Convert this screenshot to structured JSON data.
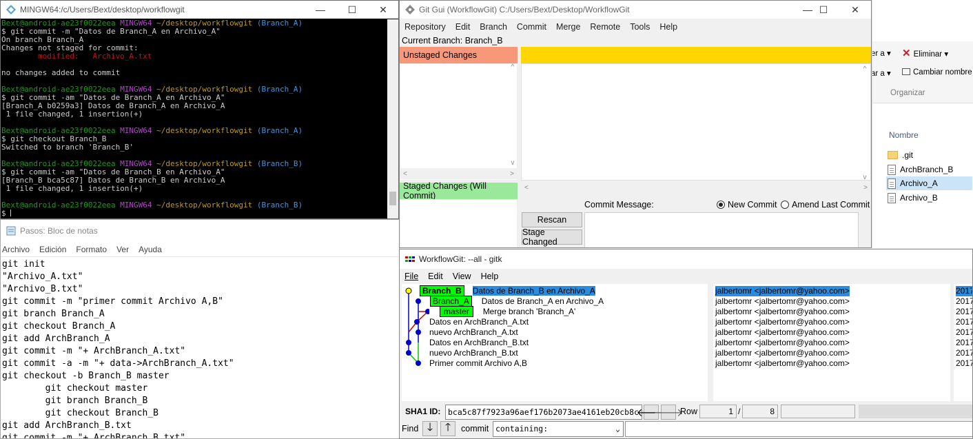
{
  "explorer": {
    "ribbon_items": [
      {
        "label": "er a",
        "caret": "▾"
      },
      {
        "label": "Eliminar",
        "caret": "▾"
      },
      {
        "label": "ar a",
        "caret": "▾"
      },
      {
        "label": "Cambiar nombre"
      }
    ],
    "group_label": "Organizar",
    "column_header": "Nombre",
    "files": [
      ".git",
      "ArchBranch_B",
      "Archivo_A",
      "Archivo_B"
    ],
    "selected_file": "Archivo_A"
  },
  "terminal": {
    "title": "MINGW64:/c/Users/Bext/desktop/workflowgit",
    "lines": [
      [
        [
          "g",
          "Bext@android-ae23f0022eea "
        ],
        [
          "m",
          "MINGW64 "
        ],
        [
          "y",
          "~/desktop/workflowgit "
        ],
        [
          "c",
          "(Branch_A)"
        ]
      ],
      [
        [
          "w",
          "$ git commit -m \"Datos de Branch_A en Archivo_A\""
        ]
      ],
      [
        [
          "w",
          "On branch Branch_A"
        ]
      ],
      [
        [
          "w",
          "Changes not staged for commit:"
        ]
      ],
      [
        [
          "r",
          "        modified:   Archivo_A.txt"
        ]
      ],
      [
        [
          "w",
          ""
        ]
      ],
      [
        [
          "w",
          "no changes added to commit"
        ]
      ],
      [
        [
          "w",
          ""
        ]
      ],
      [
        [
          "g",
          "Bext@android-ae23f0022eea "
        ],
        [
          "m",
          "MINGW64 "
        ],
        [
          "y",
          "~/desktop/workflowgit "
        ],
        [
          "c",
          "(Branch_A)"
        ]
      ],
      [
        [
          "w",
          "$ git commit -am \"Datos de Branch_A en Archivo_A\""
        ]
      ],
      [
        [
          "w",
          "[Branch_A b0259a3] Datos de Branch_A en Archivo_A"
        ]
      ],
      [
        [
          "w",
          " 1 file changed, 1 insertion(+)"
        ]
      ],
      [
        [
          "w",
          ""
        ]
      ],
      [
        [
          "g",
          "Bext@android-ae23f0022eea "
        ],
        [
          "m",
          "MINGW64 "
        ],
        [
          "y",
          "~/desktop/workflowgit "
        ],
        [
          "c",
          "(Branch_A)"
        ]
      ],
      [
        [
          "w",
          "$ git checkout Branch_B"
        ]
      ],
      [
        [
          "w",
          "Switched to branch 'Branch_B'"
        ]
      ],
      [
        [
          "w",
          ""
        ]
      ],
      [
        [
          "g",
          "Bext@android-ae23f0022eea "
        ],
        [
          "m",
          "MINGW64 "
        ],
        [
          "y",
          "~/desktop/workflowgit "
        ],
        [
          "c",
          "(Branch_B)"
        ]
      ],
      [
        [
          "w",
          "$ git commit -am \"Datos de Branch_B en Archivo_A\""
        ]
      ],
      [
        [
          "w",
          "[Branch_B bca5c87] Datos de Branch_B en Archivo_A"
        ]
      ],
      [
        [
          "w",
          " 1 file changed, 1 insertion(+)"
        ]
      ],
      [
        [
          "w",
          ""
        ]
      ],
      [
        [
          "g",
          "Bext@android-ae23f0022eea "
        ],
        [
          "m",
          "MINGW64 "
        ],
        [
          "y",
          "~/desktop/workflowgit "
        ],
        [
          "c",
          "(Branch_B)"
        ]
      ],
      [
        [
          "w",
          "$ "
        ]
      ]
    ],
    "colors": {
      "g": "#13a10e",
      "m": "#b148c6",
      "y": "#c19c00",
      "c": "#3a96dd",
      "r": "#c50f1f",
      "w": "#cccccc"
    }
  },
  "notepad": {
    "title": "Pasos: Bloc de notas",
    "menu": [
      "Archivo",
      "Edición",
      "Formato",
      "Ver",
      "Ayuda"
    ],
    "lines": [
      "git init",
      "\"Archivo_A.txt\"",
      "\"Archivo_B.txt\"",
      "git commit -m \"primer commit Archivo A,B\"",
      "git branch Branch_A",
      "git checkout Branch_A",
      "git add ArchBranch_A",
      "git commit -m \"+ ArchBranch_A.txt\"",
      "git commit -a -m \"+ data->ArchBranch_A.txt\"",
      "git checkout -b Branch_B master",
      "        git checkout master",
      "        git branch Branch_B",
      "        git checkout Branch_B",
      "git add ArchBranch_B.txt",
      "git commit -m \"+ ArchBranch_B.txt\""
    ]
  },
  "gitgui": {
    "title": "Git Gui (WorkflowGit) C:/Users/Bext/Desktop/WorkflowGit",
    "menu": [
      "Repository",
      "Edit",
      "Branch",
      "Commit",
      "Merge",
      "Remote",
      "Tools",
      "Help"
    ],
    "current_branch": "Current Branch: Branch_B",
    "unstaged_label": "Unstaged Changes",
    "staged_label": "Staged Changes (Will Commit)",
    "commit_message_label": "Commit Message:",
    "new_commit": "New Commit",
    "amend_last_commit": "Amend Last Commit",
    "rescan": "Rescan",
    "stage_changed": "Stage Changed",
    "colors": {
      "unstaged": "#f7987a",
      "staged": "#9ae89a",
      "diff_header": "#ffd700"
    }
  },
  "gitk": {
    "title": "WorkflowGit: --all - gitk",
    "menu": [
      "File",
      "Edit",
      "View",
      "Help"
    ],
    "commits": [
      {
        "tags": [
          "Branch_B"
        ],
        "subject": "Datos de Branch_B en Archivo_A",
        "author": "jalbertomr <jalbertomr@yahoo.com>",
        "date": "2017",
        "selected": true
      },
      {
        "tags": [
          "Branch_A"
        ],
        "subject": "Datos de Branch_A en Archivo_A",
        "author": "jalbertomr <jalbertomr@yahoo.com>",
        "date": "2017"
      },
      {
        "tags": [
          "master"
        ],
        "subject": "Merge branch 'Branch_A'",
        "author": "jalbertomr <jalbertomr@yahoo.com>",
        "date": "2017"
      },
      {
        "tags": [],
        "subject": "Datos en ArchBranch_A.txt",
        "author": "jalbertomr <jalbertomr@yahoo.com>",
        "date": "2017"
      },
      {
        "tags": [],
        "subject": "nuevo ArchBranch_A.txt",
        "author": "jalbertomr <jalbertomr@yahoo.com>",
        "date": "2017"
      },
      {
        "tags": [],
        "subject": "Datos en ArchBranch_B.txt",
        "author": "jalbertomr <jalbertomr@yahoo.com>",
        "date": "2017"
      },
      {
        "tags": [],
        "subject": "nuevo ArchBranch_B.txt",
        "author": "jalbertomr <jalbertomr@yahoo.com>",
        "date": "2017"
      },
      {
        "tags": [],
        "subject": "Primer commit Archivo A,B",
        "author": "jalbertomr <jalbertomr@yahoo.com>",
        "date": "2017"
      }
    ],
    "sha1_label": "SHA1 ID:",
    "sha1_value": "bca5c87f7923a96aef176b2073ae4161eb20cb8c",
    "row_label": "Row",
    "row_current": "1",
    "row_sep": "/",
    "row_total": "8",
    "find_label": "Find",
    "find_type": "commit",
    "find_mode": "containing:",
    "colors": {
      "tag": "#00ff00",
      "selected": "#2b8bdc",
      "graph_node": "#0000cc",
      "graph_line_a": "#0000cc",
      "graph_line_b": "#00cc00",
      "graph_line_m": "#cc0000"
    }
  }
}
